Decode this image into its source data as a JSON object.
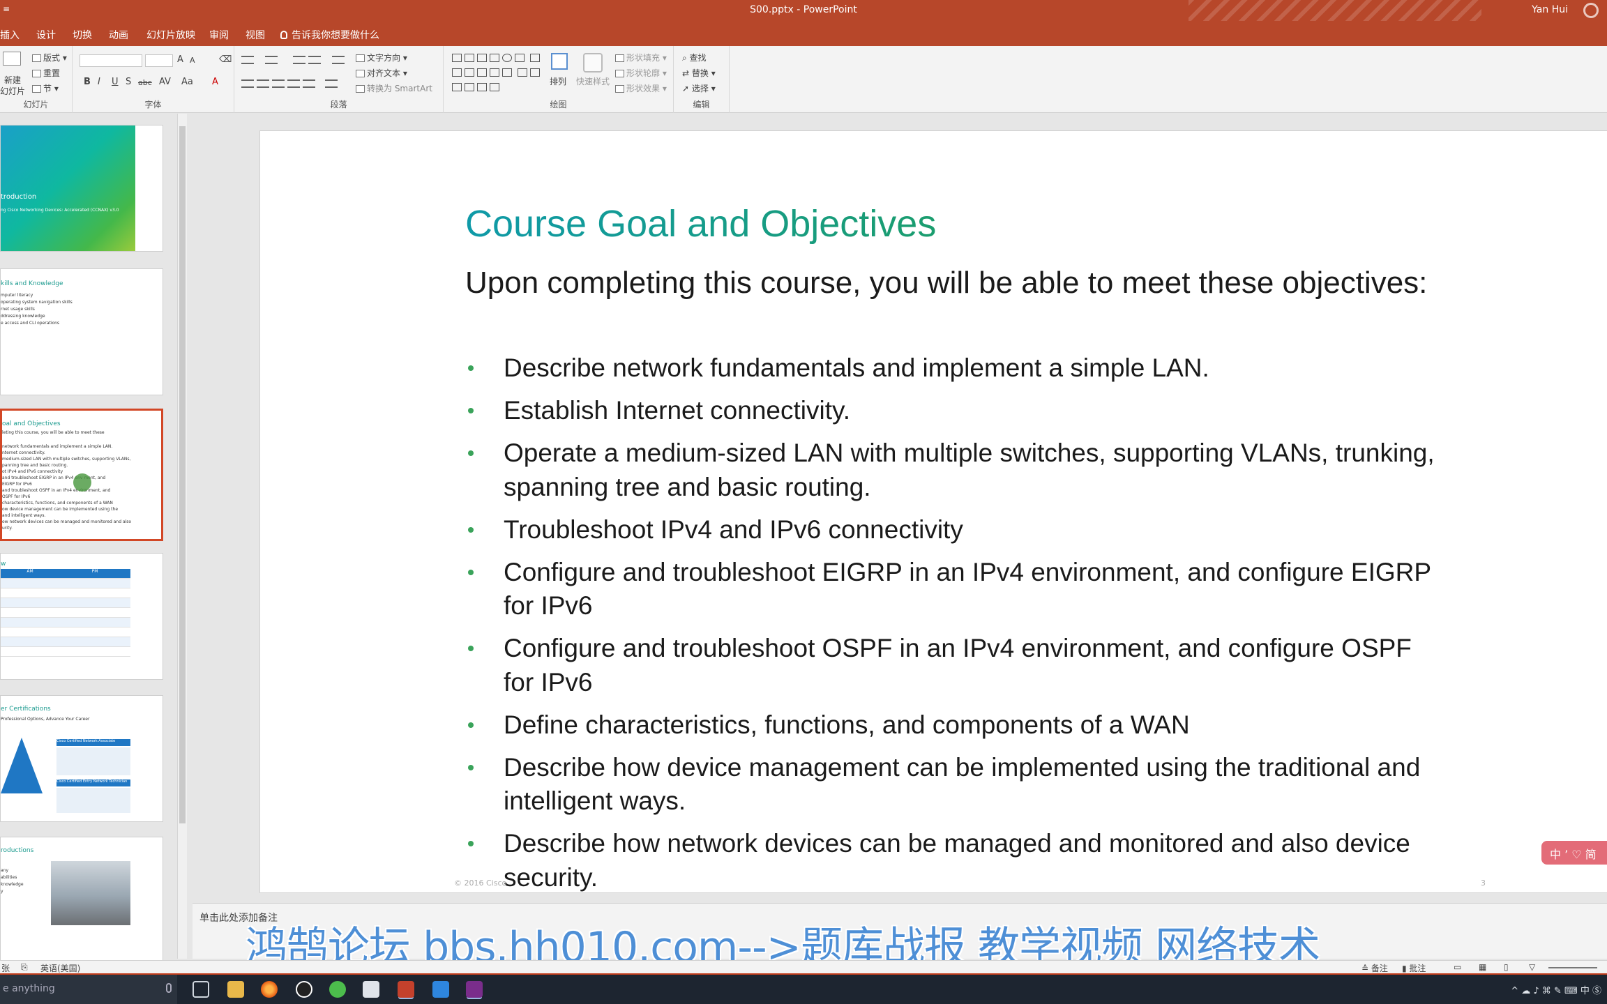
{
  "titlebar": {
    "qat": "≡",
    "title": "S00.pptx  -  PowerPoint",
    "user": "Yan Hui"
  },
  "ribbon_tabs": [
    "插入",
    "设计",
    "切换",
    "动画",
    "幻灯片放映",
    "审阅",
    "视图"
  ],
  "tell_me": "告诉我你想要做什么",
  "ribbon": {
    "slides": {
      "new_slide": "新建",
      "new_slide2": "幻灯片",
      "layout": "版式",
      "reset": "重置",
      "section": "节",
      "label": "幻灯片"
    },
    "font": {
      "label": "字体",
      "bold": "B",
      "italic": "I",
      "underline": "U",
      "strike": "S",
      "abc": "abc",
      "spacing": "AV",
      "case": "Aa",
      "grow": "A",
      "shrink": "A",
      "color": "A"
    },
    "paragraph": {
      "label": "段落",
      "text_dir": "文字方向",
      "align_text": "对齐文本",
      "smartart": "转换为 SmartArt"
    },
    "drawing": {
      "label": "绘图",
      "arrange": "排列",
      "quick_styles": "快速样式",
      "fill": "形状填充",
      "outline": "形状轮廓",
      "effects": "形状效果"
    },
    "editing": {
      "label": "编辑",
      "find": "查找",
      "replace": "替换",
      "select": "选择"
    }
  },
  "thumbnails": {
    "t1": {
      "title": "troduction",
      "sub": "ng Cisco Networking Devices: Accelerated (CCNAX) v3.0"
    },
    "t2": {
      "title": "kills and Knowledge",
      "lines": [
        "mputer literacy",
        "operating system navigation skills",
        "rnet usage skills",
        "ddressing knowledge",
        "e access and CLI operations"
      ]
    },
    "t3": {
      "title": "oal and Objectives",
      "lines": [
        "leting this course, you will be able to meet these",
        "",
        "network fundamentals and implement a simple LAN.",
        "nternet connectivity.",
        "medium-sized LAN with multiple switches, supporting VLANs,",
        "panning tree and basic routing.",
        "ot IPv4 and IPv6 connectivity",
        "and troubleshoot EIGRP in an IPv4 env ment, and",
        "EIGRP for IPv6",
        "and troubleshoot OSPF in an IPv4 environment, and",
        "OSPF for IPv6",
        "characteristics, functions, and components of a WAN",
        "ow device management can be implemented using the",
        "and intelligent ways.",
        "ow network devices can be managed and monitored and also",
        "urity."
      ]
    },
    "t4": {
      "title": "w",
      "col_am": "AM",
      "col_pm": "PM"
    },
    "t5": {
      "title": "er Certifications",
      "sub": "Professional Options, Advance Your Career",
      "box1": "Cisco Certified Network Associate",
      "box2": "Cisco Certified Entry Network Technician"
    },
    "t6": {
      "title": "roductions",
      "lines": [
        "any",
        "abilities",
        "knowledge",
        "y"
      ]
    }
  },
  "slide": {
    "title": "Course Goal and Objectives",
    "intro": "Upon completing this course, you will be able to meet these objectives:",
    "bullets": [
      "Describe network fundamentals and implement a simple LAN.",
      "Establish Internet connectivity.",
      "Operate a medium-sized LAN with multiple switches, supporting VLANs, trunking, spanning tree and basic routing.",
      "Troubleshoot IPv4 and IPv6 connectivity",
      "Configure and troubleshoot EIGRP in an IPv4 environment, and configure EIGRP for IPv6",
      "Configure and troubleshoot OSPF in an IPv4 environment, and configure OSPF for IPv6",
      "Define characteristics, functions, and components of a WAN",
      "Describe how device management can be implemented using the traditional and intelligent ways.",
      "Describe how network devices can be managed and monitored and also device security."
    ],
    "footer": "© 2016 Cisco",
    "number": "3"
  },
  "notes_hint": "单击此处添加备注",
  "ime_badge": "中 ’ ♡ 简",
  "watermark": "鸿鹄论坛 bbs.hh010.com-->题库战报 教学视频 网络技术",
  "statusbar": {
    "slide_info": "张",
    "language": "英语(美国)",
    "notes": "备注",
    "comments": "批注"
  },
  "taskbar": {
    "search": "e anything"
  },
  "tray": "^ ☁ ♪ ⌘ ✎ ⌨ 中 Ⓢ",
  "colors": {
    "accent": "#b7472a",
    "title_teal": "#17a088",
    "bullet_green": "#3aa35a",
    "selected_thumb": "#d24726"
  }
}
